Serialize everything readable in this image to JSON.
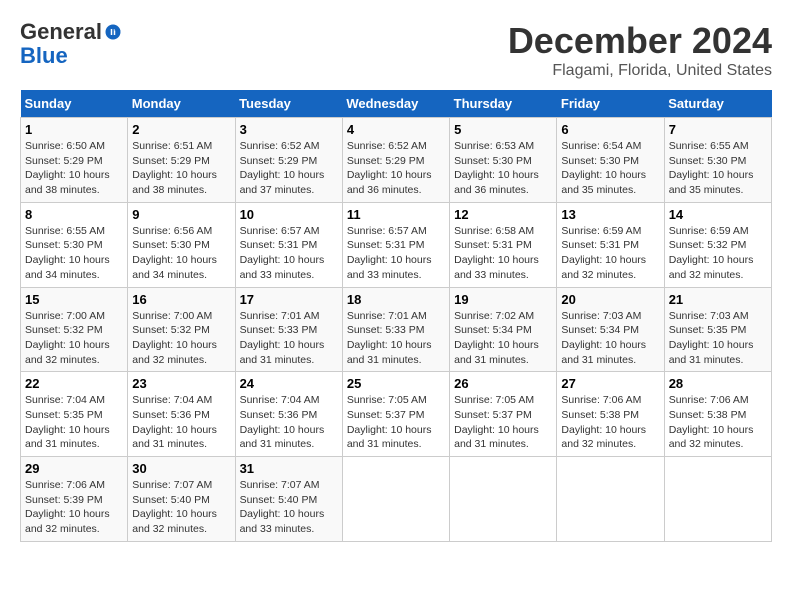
{
  "logo": {
    "line1": "General",
    "line2": "Blue"
  },
  "title": "December 2024",
  "subtitle": "Flagami, Florida, United States",
  "days_of_week": [
    "Sunday",
    "Monday",
    "Tuesday",
    "Wednesday",
    "Thursday",
    "Friday",
    "Saturday"
  ],
  "weeks": [
    [
      {
        "day": "1",
        "info": "Sunrise: 6:50 AM\nSunset: 5:29 PM\nDaylight: 10 hours\nand 38 minutes."
      },
      {
        "day": "2",
        "info": "Sunrise: 6:51 AM\nSunset: 5:29 PM\nDaylight: 10 hours\nand 38 minutes."
      },
      {
        "day": "3",
        "info": "Sunrise: 6:52 AM\nSunset: 5:29 PM\nDaylight: 10 hours\nand 37 minutes."
      },
      {
        "day": "4",
        "info": "Sunrise: 6:52 AM\nSunset: 5:29 PM\nDaylight: 10 hours\nand 36 minutes."
      },
      {
        "day": "5",
        "info": "Sunrise: 6:53 AM\nSunset: 5:30 PM\nDaylight: 10 hours\nand 36 minutes."
      },
      {
        "day": "6",
        "info": "Sunrise: 6:54 AM\nSunset: 5:30 PM\nDaylight: 10 hours\nand 35 minutes."
      },
      {
        "day": "7",
        "info": "Sunrise: 6:55 AM\nSunset: 5:30 PM\nDaylight: 10 hours\nand 35 minutes."
      }
    ],
    [
      {
        "day": "8",
        "info": "Sunrise: 6:55 AM\nSunset: 5:30 PM\nDaylight: 10 hours\nand 34 minutes."
      },
      {
        "day": "9",
        "info": "Sunrise: 6:56 AM\nSunset: 5:30 PM\nDaylight: 10 hours\nand 34 minutes."
      },
      {
        "day": "10",
        "info": "Sunrise: 6:57 AM\nSunset: 5:31 PM\nDaylight: 10 hours\nand 33 minutes."
      },
      {
        "day": "11",
        "info": "Sunrise: 6:57 AM\nSunset: 5:31 PM\nDaylight: 10 hours\nand 33 minutes."
      },
      {
        "day": "12",
        "info": "Sunrise: 6:58 AM\nSunset: 5:31 PM\nDaylight: 10 hours\nand 33 minutes."
      },
      {
        "day": "13",
        "info": "Sunrise: 6:59 AM\nSunset: 5:31 PM\nDaylight: 10 hours\nand 32 minutes."
      },
      {
        "day": "14",
        "info": "Sunrise: 6:59 AM\nSunset: 5:32 PM\nDaylight: 10 hours\nand 32 minutes."
      }
    ],
    [
      {
        "day": "15",
        "info": "Sunrise: 7:00 AM\nSunset: 5:32 PM\nDaylight: 10 hours\nand 32 minutes."
      },
      {
        "day": "16",
        "info": "Sunrise: 7:00 AM\nSunset: 5:32 PM\nDaylight: 10 hours\nand 32 minutes."
      },
      {
        "day": "17",
        "info": "Sunrise: 7:01 AM\nSunset: 5:33 PM\nDaylight: 10 hours\nand 31 minutes."
      },
      {
        "day": "18",
        "info": "Sunrise: 7:01 AM\nSunset: 5:33 PM\nDaylight: 10 hours\nand 31 minutes."
      },
      {
        "day": "19",
        "info": "Sunrise: 7:02 AM\nSunset: 5:34 PM\nDaylight: 10 hours\nand 31 minutes."
      },
      {
        "day": "20",
        "info": "Sunrise: 7:03 AM\nSunset: 5:34 PM\nDaylight: 10 hours\nand 31 minutes."
      },
      {
        "day": "21",
        "info": "Sunrise: 7:03 AM\nSunset: 5:35 PM\nDaylight: 10 hours\nand 31 minutes."
      }
    ],
    [
      {
        "day": "22",
        "info": "Sunrise: 7:04 AM\nSunset: 5:35 PM\nDaylight: 10 hours\nand 31 minutes."
      },
      {
        "day": "23",
        "info": "Sunrise: 7:04 AM\nSunset: 5:36 PM\nDaylight: 10 hours\nand 31 minutes."
      },
      {
        "day": "24",
        "info": "Sunrise: 7:04 AM\nSunset: 5:36 PM\nDaylight: 10 hours\nand 31 minutes."
      },
      {
        "day": "25",
        "info": "Sunrise: 7:05 AM\nSunset: 5:37 PM\nDaylight: 10 hours\nand 31 minutes."
      },
      {
        "day": "26",
        "info": "Sunrise: 7:05 AM\nSunset: 5:37 PM\nDaylight: 10 hours\nand 31 minutes."
      },
      {
        "day": "27",
        "info": "Sunrise: 7:06 AM\nSunset: 5:38 PM\nDaylight: 10 hours\nand 32 minutes."
      },
      {
        "day": "28",
        "info": "Sunrise: 7:06 AM\nSunset: 5:38 PM\nDaylight: 10 hours\nand 32 minutes."
      }
    ],
    [
      {
        "day": "29",
        "info": "Sunrise: 7:06 AM\nSunset: 5:39 PM\nDaylight: 10 hours\nand 32 minutes."
      },
      {
        "day": "30",
        "info": "Sunrise: 7:07 AM\nSunset: 5:40 PM\nDaylight: 10 hours\nand 32 minutes."
      },
      {
        "day": "31",
        "info": "Sunrise: 7:07 AM\nSunset: 5:40 PM\nDaylight: 10 hours\nand 33 minutes."
      },
      {
        "day": "",
        "info": ""
      },
      {
        "day": "",
        "info": ""
      },
      {
        "day": "",
        "info": ""
      },
      {
        "day": "",
        "info": ""
      }
    ]
  ]
}
